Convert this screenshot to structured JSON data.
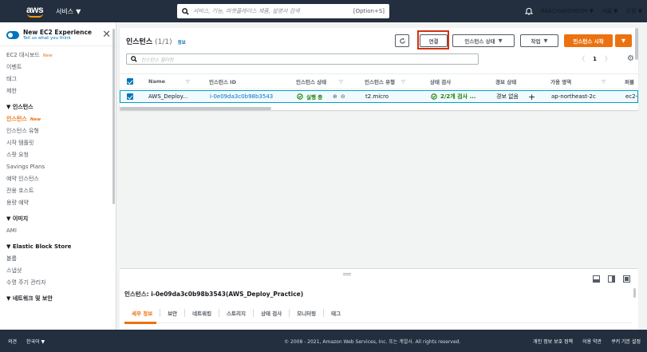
{
  "topbar": {
    "logo": "aws",
    "services": "서비스",
    "search_placeholder": "서비스, 기능, 마켓플레이스 제품, 설명서 검색",
    "search_shortcut": "[Option+S]",
    "user": "BAECHAEGYEOM",
    "region": "서울",
    "support": "지원"
  },
  "sidebar": {
    "experience_title": "New EC2 Experience",
    "experience_sub": "Tell us what you think",
    "new_badge": "New",
    "items_top": [
      "EC2 대시보드",
      "이벤트",
      "태그",
      "제한"
    ],
    "section_instances": "인스턴스",
    "instances_items": [
      "인스턴스",
      "인스턴스 유형",
      "시작 템플릿",
      "스팟 요청",
      "Savings Plans",
      "예약 인스턴스",
      "전용 호스트",
      "용량 예약"
    ],
    "section_images": "이미지",
    "images_items": [
      "AMI"
    ],
    "section_ebs": "Elastic Block Store",
    "ebs_items": [
      "볼륨",
      "스냅샷",
      "수명 주기 관리자"
    ],
    "section_network": "네트워크 및 보안"
  },
  "panel": {
    "title": "인스턴스",
    "count": "(1/1)",
    "info": "정보",
    "refresh_icon": "refresh-icon",
    "connect": "연결",
    "instance_state": "인스턴스 상태",
    "actions": "작업",
    "launch": "인스턴스 시작",
    "filter_placeholder": "인스턴스 필터링",
    "page": "1"
  },
  "table": {
    "headers": [
      "Name",
      "인스턴스 ID",
      "인스턴스 상태",
      "인스턴스 유형",
      "상태 검사",
      "경보 상태",
      "가용 영역",
      "퍼블"
    ],
    "row": {
      "name": "AWS_Deploy...",
      "id": "i-0e09da3c0b98b3543",
      "state": "실행 중",
      "type": "t2.micro",
      "check": "2/2개 검사 ...",
      "alarm": "경보 없음",
      "az": "ap-northeast-2c",
      "public": "ec2-"
    }
  },
  "detail": {
    "title": "인스턴스: i-0e09da3c0b98b3543(AWS_Deploy_Practice)",
    "tabs": [
      "세부 정보",
      "보안",
      "네트워킹",
      "스토리지",
      "상태 검사",
      "모니터링",
      "태그"
    ]
  },
  "footer": {
    "feedback": "의견",
    "language": "한국어",
    "copyright": "© 2008 - 2021, Amazon Web Services, Inc. 또는 계열사. All rights reserved.",
    "privacy": "개인 정보 보호 정책",
    "terms": "이용 약관",
    "cookies": "쿠키 기본 설정"
  }
}
